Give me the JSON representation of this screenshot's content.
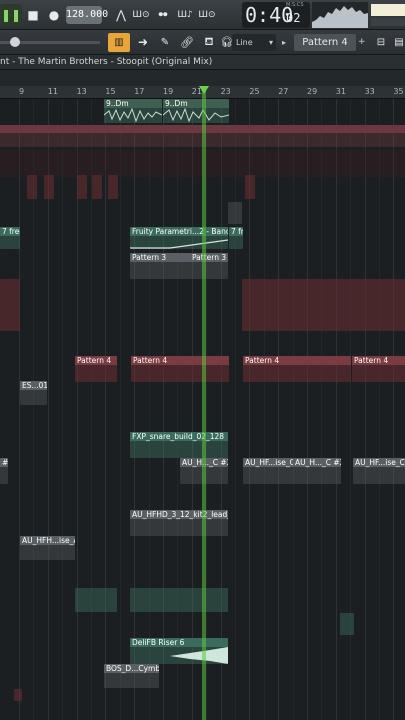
{
  "toolbar": {
    "tempo": "128.000",
    "time_main": "0:40",
    "time_sub": "02",
    "time_unit": "M:S:CS",
    "snap_label": "Line",
    "pattern_label": "Pattern 4"
  },
  "title": "nt - The Martin Brothers - Stoopit (Original Mix)",
  "ruler": {
    "ticks": [
      "9",
      "11",
      "13",
      "15",
      "17",
      "19",
      "21",
      "23",
      "25",
      "27",
      "29",
      "31",
      "33",
      "35"
    ]
  },
  "clips": {
    "dm": "9..Dm",
    "dm2": "9..Dm",
    "param_a": "7 freq",
    "param_b": "Fruity Parametri...2 - Band 7 freq",
    "param_c": "7 freq",
    "pattern3a": "Pattern 3",
    "pattern3b": "Pattern 3",
    "pattern4a": "Pattern 4",
    "pattern4b": "Pattern 4",
    "pattern4c": "Pattern 4",
    "pattern4d": "Pattern 4",
    "es": "ES...01",
    "snare": "FXP_snare_build_02_128",
    "au_hc1": "AU_H..._C #2",
    "au_hf1": "AU_HF...ise_C",
    "au_hc2": "AU_H..._C #2",
    "au_hf2": "AU_HF...ise_C",
    "hfhd": "AU_HFHD_3_12_kit2_lead_C",
    "hfh_ise": "AU_HFH...ise_A",
    "riser": "DeliFB Riser 6",
    "cymbal": "BOS_D...Cymbal",
    "small_a": "#2"
  },
  "colors": {
    "accent_orange": "#e8a53a",
    "clip_red": "#7a3c42",
    "clip_green": "#3a6b5c",
    "playhead": "#6ad14a"
  }
}
